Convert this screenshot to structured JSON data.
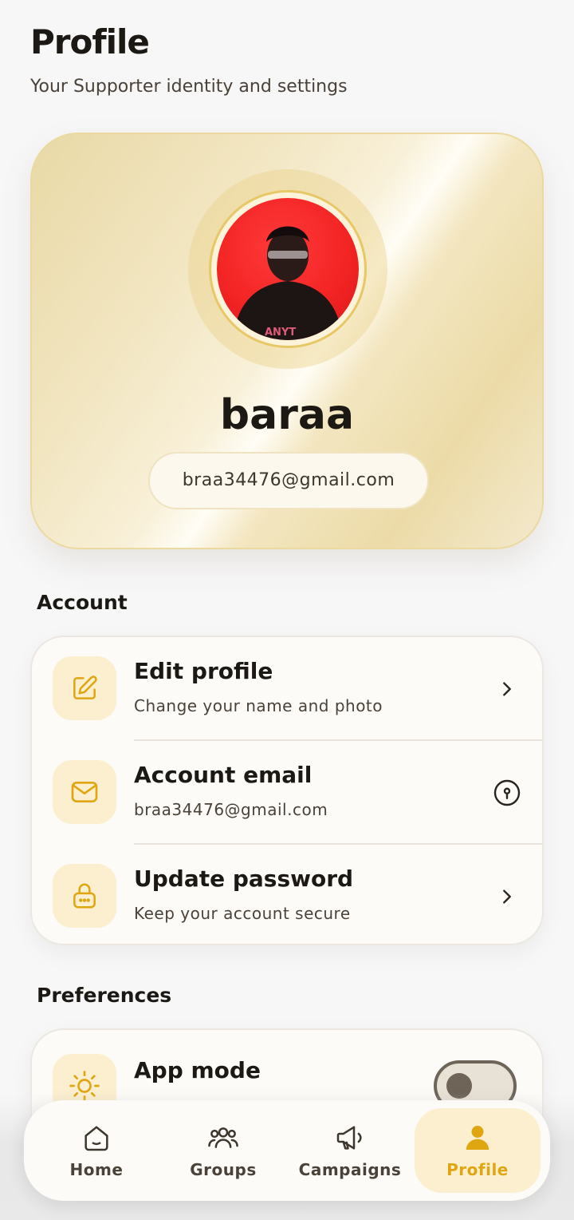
{
  "header": {
    "title": "Profile",
    "subtitle": "Your Supporter identity and settings"
  },
  "profile_card": {
    "name": "baraa",
    "email": "braa34476@gmail.com",
    "shirt_text": "ANYT"
  },
  "account": {
    "section_title": "Account",
    "rows": [
      {
        "title": "Edit profile",
        "subtitle": "Change your name and photo",
        "icon": "pencil-edit-icon",
        "action": "chevron-right-icon"
      },
      {
        "title": "Account email",
        "subtitle": "braa34476@gmail.com",
        "icon": "mail-icon",
        "action": "key-info-icon"
      },
      {
        "title": "Update password",
        "subtitle": "Keep your account secure",
        "icon": "lock-icon",
        "action": "chevron-right-icon"
      }
    ]
  },
  "preferences": {
    "section_title": "Preferences",
    "rows": [
      {
        "title": "App mode",
        "icon": "sun-icon",
        "toggle_on": false
      }
    ]
  },
  "nav": {
    "items": [
      {
        "label": "Home",
        "icon": "home-icon",
        "active": false
      },
      {
        "label": "Groups",
        "icon": "groups-icon",
        "active": false
      },
      {
        "label": "Campaigns",
        "icon": "megaphone-icon",
        "active": false
      },
      {
        "label": "Profile",
        "icon": "person-icon",
        "active": true
      }
    ]
  },
  "colors": {
    "accent": "#e0a611",
    "icon_bg": "#fbefcf",
    "text_dark": "#1c1914",
    "text_muted": "#4a4238"
  }
}
